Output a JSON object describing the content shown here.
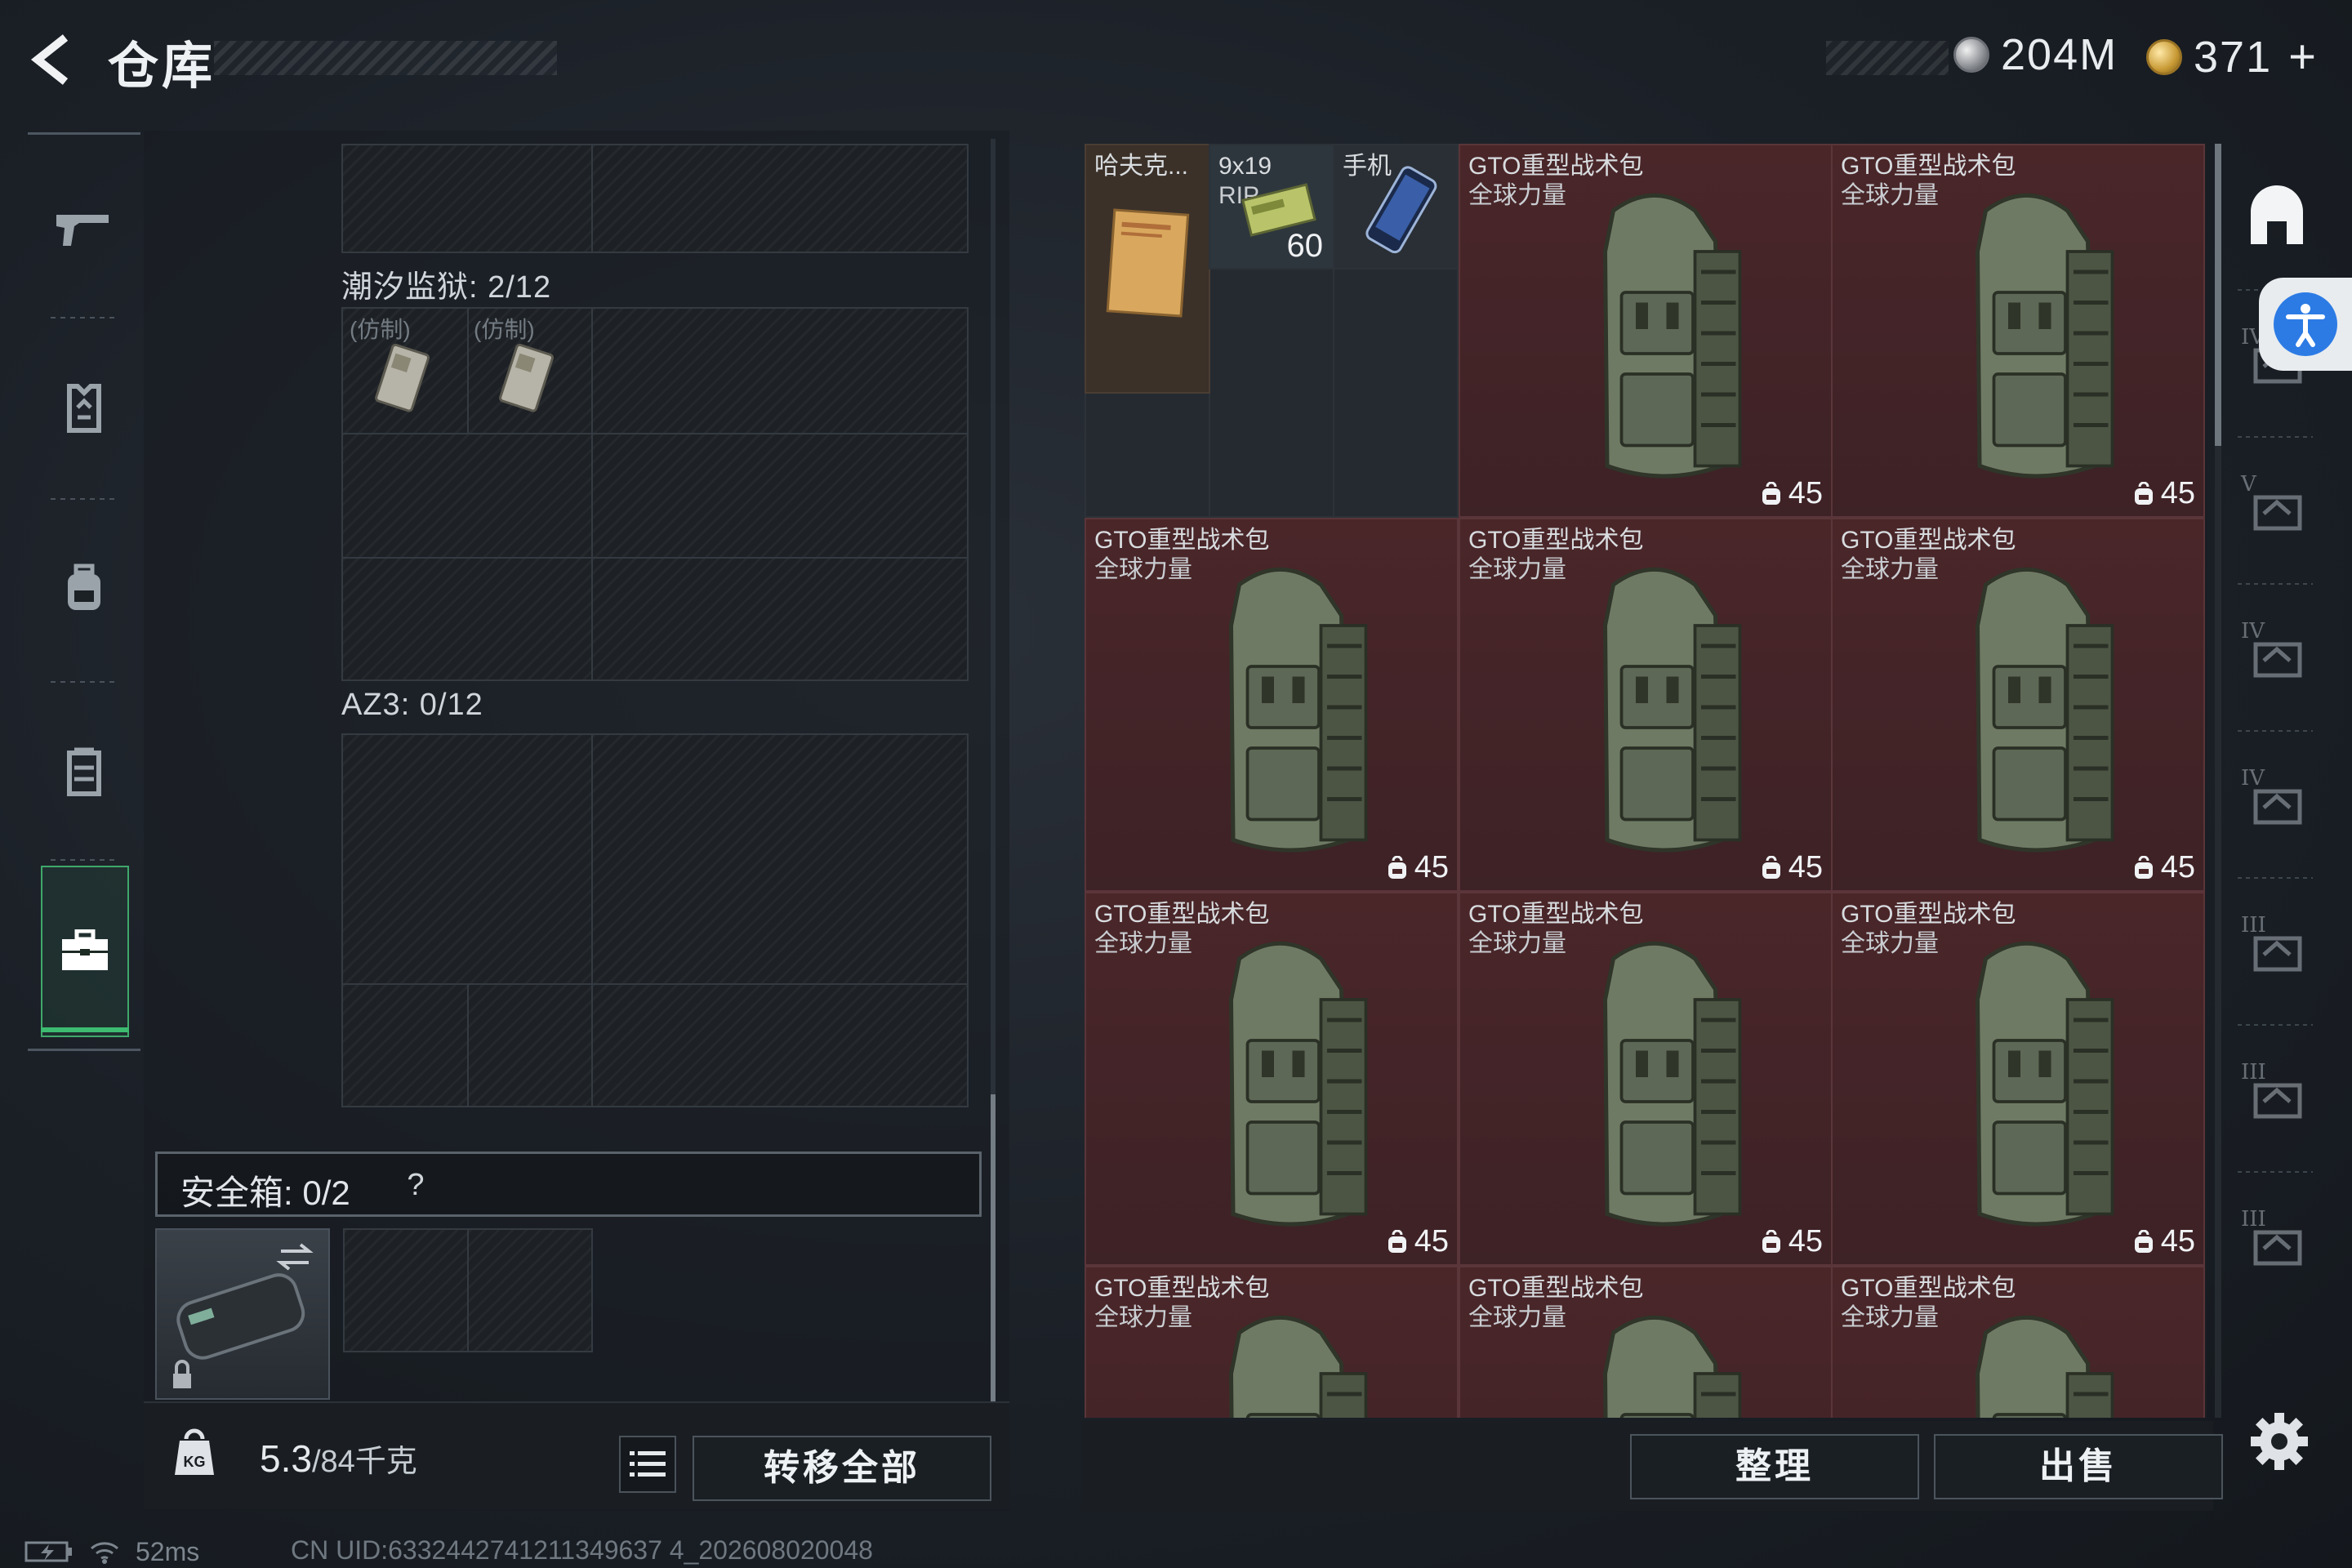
{
  "header": {
    "title": "仓库",
    "currency": [
      {
        "icon": "silver-coin-icon",
        "value": "204M"
      },
      {
        "icon": "gold-coin-icon",
        "value": "371"
      }
    ],
    "plus": "+"
  },
  "left_nav": {
    "items": [
      {
        "icon": "gun-icon",
        "active": false
      },
      {
        "icon": "vest-icon",
        "active": false
      },
      {
        "icon": "backpack-icon",
        "active": false
      },
      {
        "icon": "rig-icon",
        "active": false
      },
      {
        "icon": "briefcase-icon",
        "active": true
      }
    ],
    "active_color": "#3dbb70"
  },
  "containers": {
    "section1": {
      "label": "潮汐监狱: 2/12",
      "items": [
        {
          "label": "(仿制)"
        },
        {
          "label": "(仿制)"
        }
      ]
    },
    "section2": {
      "label": "AZ3: 0/12"
    },
    "safe": {
      "label": "安全箱: 0/2",
      "help": "?"
    }
  },
  "weight": {
    "current": "5.3",
    "max": "/84",
    "unit": "千克"
  },
  "buttons": {
    "transfer_all": "转移全部",
    "sort": "整理",
    "sell": "出售"
  },
  "stash": {
    "small_items": [
      {
        "name": "哈夫克...",
        "type": "book"
      },
      {
        "name": "9x19",
        "sub": "RIP",
        "qty": "60",
        "type": "ammo"
      },
      {
        "name": "手机",
        "type": "phone"
      }
    ],
    "backpacks": [
      {
        "name": "GTO重型战术包",
        "tag": "全球力量",
        "capacity": "45"
      },
      {
        "name": "GTO重型战术包",
        "tag": "全球力量",
        "capacity": "45"
      },
      {
        "name": "GTO重型战术包",
        "tag": "全球力量",
        "capacity": "45"
      },
      {
        "name": "GTO重型战术包",
        "tag": "全球力量",
        "capacity": "45"
      },
      {
        "name": "GTO重型战术包",
        "tag": "全球力量",
        "capacity": "45"
      },
      {
        "name": "GTO重型战术包",
        "tag": "全球力量",
        "capacity": "45"
      },
      {
        "name": "GTO重型战术包",
        "tag": "全球力量",
        "capacity": "45"
      },
      {
        "name": "GTO重型战术包",
        "tag": "全球力量",
        "capacity": "45"
      },
      {
        "name": "GTO重型战术包",
        "tag": "全球力量",
        "capacity": ""
      },
      {
        "name": "GTO重型战术包",
        "tag": "全球力量",
        "capacity": ""
      },
      {
        "name": "GTO重型战术包",
        "tag": "全球力量",
        "capacity": ""
      }
    ],
    "item_bg_color": "#4a2629"
  },
  "filters": [
    {
      "icon": "home-storage-icon"
    },
    {
      "icon": "armor-iv-icon",
      "label": "IV"
    },
    {
      "icon": "helmet-v-icon",
      "label": "V"
    },
    {
      "icon": "rig-iv-icon",
      "label": "IV"
    },
    {
      "icon": "rig-iv-b-icon",
      "label": "IV"
    },
    {
      "icon": "vest-iii-icon",
      "label": "III"
    },
    {
      "icon": "vest-iii-b-icon",
      "label": "III"
    },
    {
      "icon": "vest-iii-c-icon",
      "label": "III"
    }
  ],
  "status": {
    "ping": "52ms",
    "uid": "CN UID:6332442741211349637 4_202608020048"
  }
}
